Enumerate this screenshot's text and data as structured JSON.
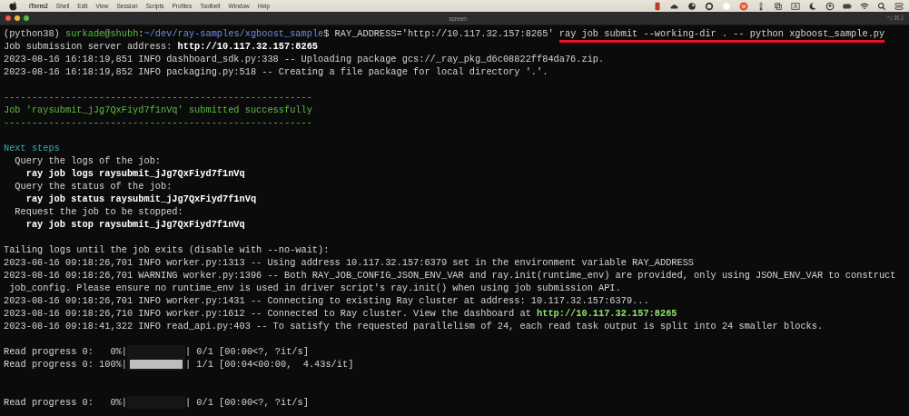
{
  "menu_bar": {
    "app": "iTerm2",
    "items": [
      "Shell",
      "Edit",
      "View",
      "Session",
      "Scripts",
      "Profiles",
      "Toolbelt",
      "Window",
      "Help"
    ]
  },
  "window": {
    "title": "screen",
    "shortcut": "⌥⌘2"
  },
  "terminal": {
    "lines": [
      {
        "kind": "text",
        "segments": [
          {
            "kind": "plain",
            "text": "(python38) "
          },
          {
            "kind": "green",
            "text": "surkade@shubh"
          },
          {
            "kind": "plain",
            "text": ":"
          },
          {
            "kind": "blue",
            "text": "~/dev/ray-samples/xgboost_sample"
          },
          {
            "kind": "plain",
            "text": "$ RAY_ADDRESS='http://10.117.32.157:8265' "
          },
          {
            "kind": "plain",
            "text": "ray job submit --working-dir . -- python xgboost_sample.py",
            "underlined": true
          }
        ]
      },
      {
        "kind": "text",
        "segments": [
          {
            "kind": "plain",
            "text": "Job submission server address: "
          },
          {
            "kind": "bold",
            "text": "http://10.117.32.157:8265"
          }
        ]
      },
      {
        "kind": "text",
        "segments": [
          {
            "kind": "plain",
            "text": "2023-08-16 16:18:19,851 INFO dashboard_sdk.py:338 -- Uploading package gcs://_ray_pkg_d6c08822ff84da76.zip."
          }
        ]
      },
      {
        "kind": "text",
        "segments": [
          {
            "kind": "plain",
            "text": "2023-08-16 16:18:19,852 INFO packaging.py:518 -- Creating a file package for local directory '.'."
          }
        ]
      },
      {
        "kind": "blank"
      },
      {
        "kind": "text",
        "segments": [
          {
            "kind": "green",
            "text": "-------------------------------------------------------"
          }
        ]
      },
      {
        "kind": "text",
        "segments": [
          {
            "kind": "green",
            "text": "Job 'raysubmit_jJg7QxFiyd7f1nVq' submitted successfully"
          }
        ]
      },
      {
        "kind": "text",
        "segments": [
          {
            "kind": "green",
            "text": "-------------------------------------------------------"
          }
        ]
      },
      {
        "kind": "blank"
      },
      {
        "kind": "text",
        "segments": [
          {
            "kind": "cyan",
            "text": "Next steps"
          }
        ]
      },
      {
        "kind": "text",
        "segments": [
          {
            "kind": "plain",
            "text": "  Query the logs of the job:"
          }
        ]
      },
      {
        "kind": "text",
        "segments": [
          {
            "kind": "bold",
            "text": "    ray job logs raysubmit_jJg7QxFiyd7f1nVq"
          }
        ]
      },
      {
        "kind": "text",
        "segments": [
          {
            "kind": "plain",
            "text": "  Query the status of the job:"
          }
        ]
      },
      {
        "kind": "text",
        "segments": [
          {
            "kind": "bold",
            "text": "    ray job status raysubmit_jJg7QxFiyd7f1nVq"
          }
        ]
      },
      {
        "kind": "text",
        "segments": [
          {
            "kind": "plain",
            "text": "  Request the job to be stopped:"
          }
        ]
      },
      {
        "kind": "text",
        "segments": [
          {
            "kind": "bold",
            "text": "    ray job stop raysubmit_jJg7QxFiyd7f1nVq"
          }
        ]
      },
      {
        "kind": "blank"
      },
      {
        "kind": "text",
        "segments": [
          {
            "kind": "plain",
            "text": "Tailing logs until the job exits (disable with --no-wait):"
          }
        ]
      },
      {
        "kind": "text",
        "segments": [
          {
            "kind": "plain",
            "text": "2023-08-16 09:18:26,701 INFO worker.py:1313 -- Using address 10.117.32.157:6379 set in the environment variable RAY_ADDRESS"
          }
        ]
      },
      {
        "kind": "text",
        "segments": [
          {
            "kind": "plain",
            "text": "2023-08-16 09:18:26,701 WARNING worker.py:1396 -- Both RAY_JOB_CONFIG_JSON_ENV_VAR and ray.init(runtime_env) are provided, only using JSON_ENV_VAR to construct"
          }
        ]
      },
      {
        "kind": "text",
        "segments": [
          {
            "kind": "plain",
            "text": " job_config. Please ensure no runtime_env is used in driver script's ray.init() when using job submission API."
          }
        ]
      },
      {
        "kind": "text",
        "segments": [
          {
            "kind": "plain",
            "text": "2023-08-16 09:18:26,701 INFO worker.py:1431 -- Connecting to existing Ray cluster at address: 10.117.32.157:6379..."
          }
        ]
      },
      {
        "kind": "text",
        "segments": [
          {
            "kind": "plain",
            "text": "2023-08-16 09:18:26,710 INFO worker.py:1612 -- Connected to Ray cluster. View the dashboard at "
          },
          {
            "kind": "link",
            "text": "http://10.117.32.157:8265"
          }
        ]
      },
      {
        "kind": "text",
        "segments": [
          {
            "kind": "plain",
            "text": "2023-08-16 09:18:41,322 INFO read_api.py:403 -- To satisfy the requested parallelism of 24, each read task output is split into 24 smaller blocks."
          }
        ]
      },
      {
        "kind": "blank"
      },
      {
        "kind": "progress",
        "label": "Read progress 0:   0%|",
        "level": 0,
        "reading": "| 0/1 [00:00<?, ?it/s]"
      },
      {
        "kind": "progress",
        "label": "Read progress 0: 100%|",
        "level": 1,
        "reading": "| 1/1 [00:04<00:00,  4.43s/it]"
      },
      {
        "kind": "blank"
      },
      {
        "kind": "blank"
      },
      {
        "kind": "progress",
        "label": "Read progress 0:   0%|",
        "level": 0,
        "reading": "| 0/1 [00:00<?, ?it/s]"
      }
    ]
  }
}
